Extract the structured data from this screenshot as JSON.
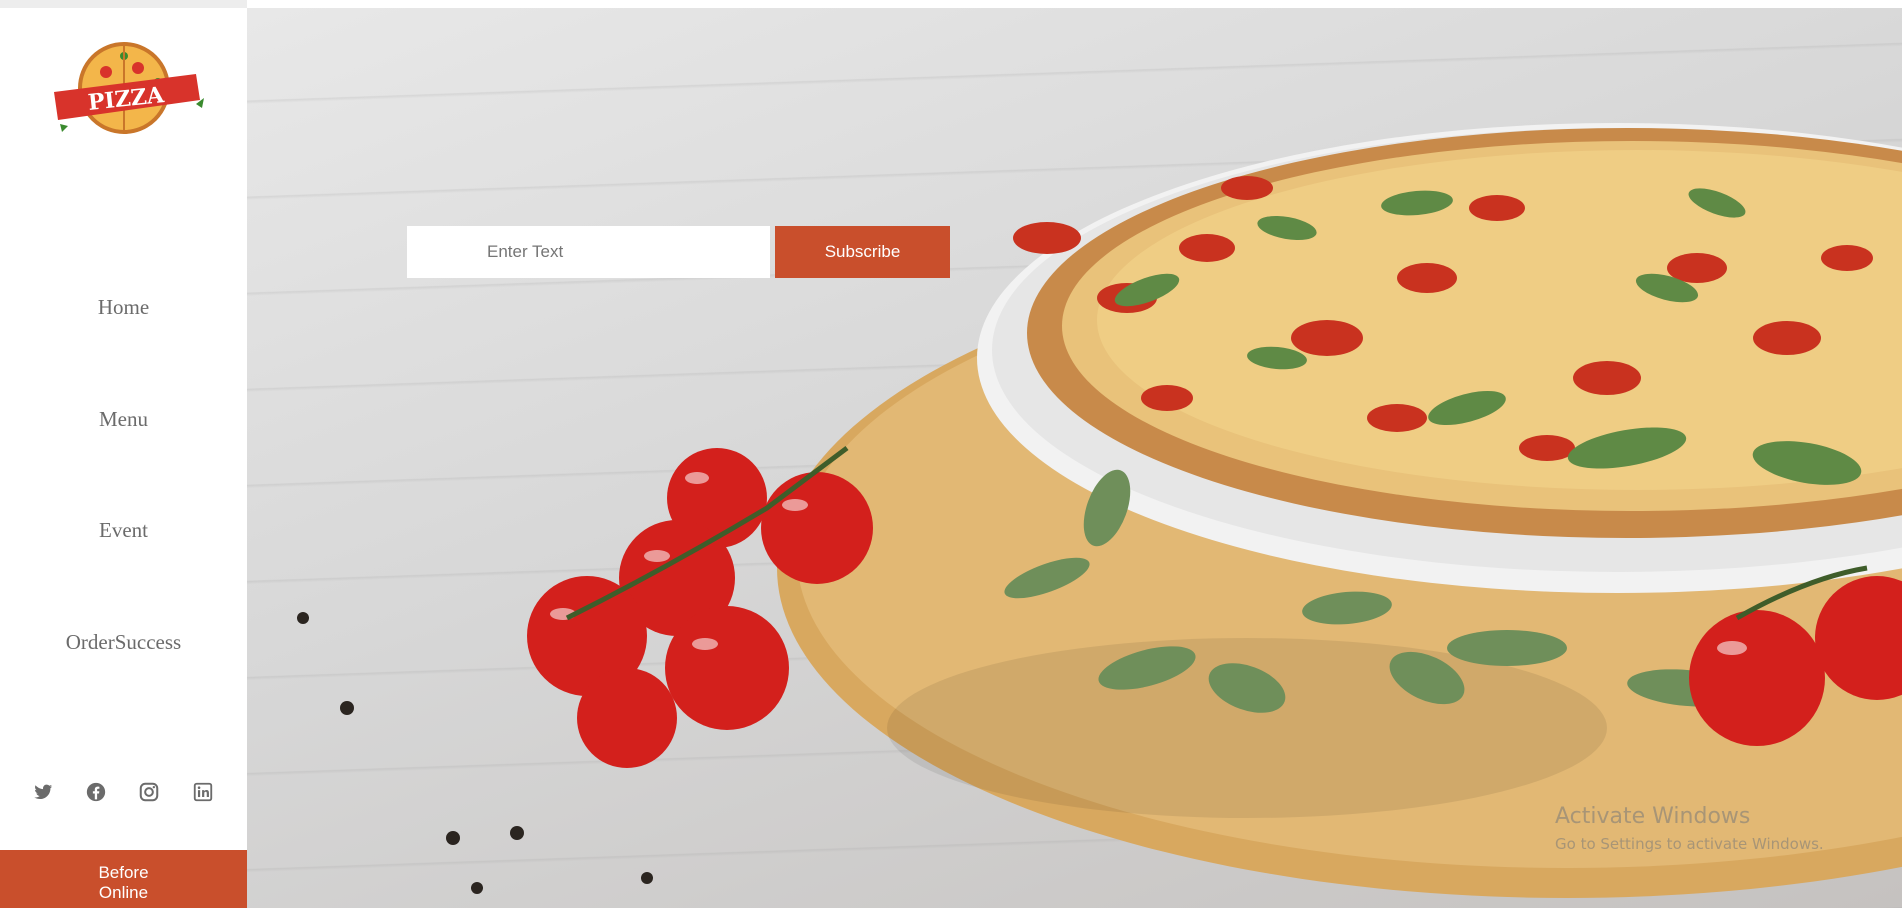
{
  "sidebar": {
    "logo": {
      "text": "PIZZA",
      "alt_text": "pizza-logo"
    },
    "nav": [
      {
        "label": "Home"
      },
      {
        "label": "Menu"
      },
      {
        "label": "Event"
      },
      {
        "label": "OrderSuccess"
      }
    ],
    "social": [
      {
        "icon": "twitter-icon"
      },
      {
        "icon": "facebook-icon"
      },
      {
        "icon": "instagram-icon"
      },
      {
        "icon": "linkedin-icon"
      }
    ],
    "cta": {
      "line1": "Before",
      "line2": "Online"
    }
  },
  "hero": {
    "subscribe": {
      "placeholder": "Enter Text",
      "button_label": "Subscribe"
    }
  },
  "watermark": {
    "title": "Activate Windows",
    "subtitle": "Go to Settings to activate Windows."
  },
  "colors": {
    "accent": "#c94f2c",
    "nav_text": "#6b6b6b",
    "sidebar_bg": "#ffffff"
  }
}
